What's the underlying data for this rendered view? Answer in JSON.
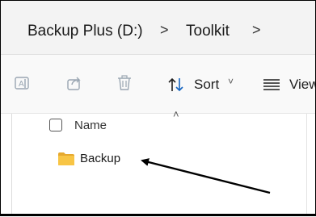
{
  "breadcrumb": {
    "items": [
      "Backup Plus (D:)",
      "Toolkit"
    ],
    "separator": ">"
  },
  "toolbar": {
    "sort_label": "Sort",
    "view_label": "View",
    "icons": [
      "rename-icon",
      "share-icon",
      "delete-icon",
      "sort-icon",
      "view-icon"
    ]
  },
  "list": {
    "column_name": "Name",
    "items": [
      {
        "label": "Backup",
        "icon": "folder-icon"
      }
    ]
  },
  "colors": {
    "address_bar_bg": "#f3f3f3",
    "toolbar_bg": "#f9f9f9",
    "folder": "#f8c545",
    "sort_icon": "#1565c0",
    "disabled_icon": "#9aa6b2",
    "annotation_arrow": "#000000"
  }
}
